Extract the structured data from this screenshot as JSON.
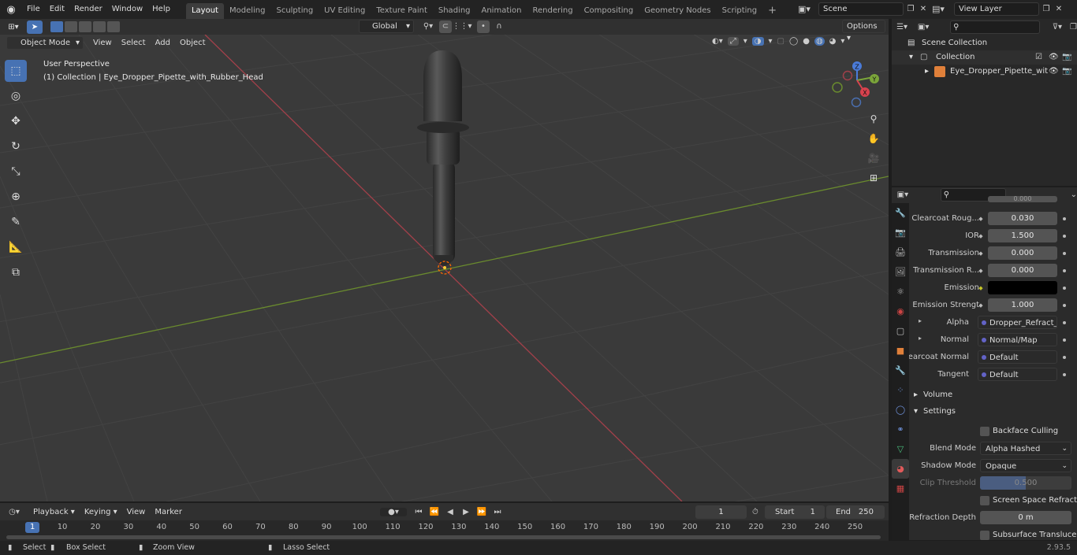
{
  "menu": {
    "items": [
      "File",
      "Edit",
      "Render",
      "Window",
      "Help"
    ],
    "workspaces": [
      "Layout",
      "Modeling",
      "Sculpting",
      "UV Editing",
      "Texture Paint",
      "Shading",
      "Animation",
      "Rendering",
      "Compositing",
      "Geometry Nodes",
      "Scripting"
    ],
    "active_workspace": "Layout",
    "add_tab": "+",
    "scene": "Scene",
    "view_layer": "View Layer"
  },
  "viewport_header": {
    "mode": "Object Mode",
    "menus": [
      "View",
      "Select",
      "Add",
      "Object"
    ],
    "transform": "Global",
    "options": "Options"
  },
  "viewport": {
    "perspective": "User Perspective",
    "collection_label": "(1) Collection | Eye_Dropper_Pipette_with_Rubber_Head",
    "gizmo": {
      "z": "Z",
      "y": "Y",
      "x": "X"
    }
  },
  "outliner": {
    "scene_collection": "Scene Collection",
    "collection": "Collection",
    "object": "Eye_Dropper_Pipette_wit"
  },
  "properties": {
    "partial_top": "0.000",
    "rows": [
      {
        "label": "Clearcoat Roug...",
        "value": "0.030",
        "kind": "num"
      },
      {
        "label": "IOR",
        "value": "1.500",
        "kind": "num"
      },
      {
        "label": "Transmission",
        "value": "0.000",
        "kind": "num"
      },
      {
        "label": "Transmission R...",
        "value": "0.000",
        "kind": "num"
      },
      {
        "label": "Emission",
        "value": "",
        "kind": "color"
      },
      {
        "label": "Emission Strengt",
        "value": "1.000",
        "kind": "num"
      },
      {
        "label": "Alpha",
        "value": "Dropper_Refract_inv...",
        "kind": "link"
      },
      {
        "label": "Normal",
        "value": "Normal/Map",
        "kind": "link"
      },
      {
        "label": "Clearcoat Normal",
        "value": "Default",
        "kind": "link"
      },
      {
        "label": "Tangent",
        "value": "Default",
        "kind": "link"
      }
    ],
    "volume_panel": "Volume",
    "settings_panel": "Settings",
    "backface_culling": "Backface Culling",
    "blend_mode_label": "Blend Mode",
    "blend_mode": "Alpha Hashed",
    "shadow_mode_label": "Shadow Mode",
    "shadow_mode": "Opaque",
    "clip_threshold_label": "Clip Threshold",
    "clip_threshold": "0.500",
    "screen_space_refraction": "Screen Space Refraction",
    "refraction_depth_label": "Refraction Depth",
    "refraction_depth": "0 m",
    "subsurface_translucency": "Subsurface Translucency",
    "colors": {
      "emission": "#000000",
      "accent": "#4772b3"
    }
  },
  "timeline": {
    "menus": [
      "Playback",
      "Keying",
      "View",
      "Marker"
    ],
    "current_frame": "1",
    "start_label": "Start",
    "start": "1",
    "end_label": "End",
    "end": "250",
    "ticks": [
      "1",
      "10",
      "20",
      "30",
      "40",
      "50",
      "60",
      "70",
      "80",
      "90",
      "100",
      "110",
      "120",
      "130",
      "140",
      "150",
      "160",
      "170",
      "180",
      "190",
      "200",
      "210",
      "220",
      "230",
      "240",
      "250"
    ]
  },
  "status": {
    "select": "Select",
    "box_select": "Box Select",
    "zoom_view": "Zoom View",
    "lasso_select": "Lasso Select",
    "version": "2.93.5"
  }
}
